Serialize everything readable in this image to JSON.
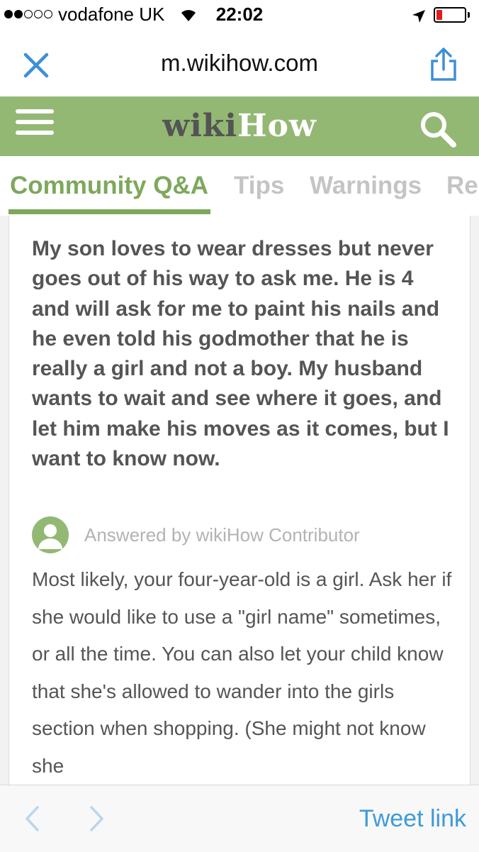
{
  "status_bar": {
    "carrier": "vodafone UK",
    "time": "22:02",
    "signal_bars_filled": 2,
    "signal_bars_total": 5,
    "battery_level": "low",
    "battery_color": "#e01d1d"
  },
  "browser": {
    "url": "m.wikihow.com",
    "close_icon": "close-icon",
    "share_icon": "share-icon"
  },
  "header": {
    "logo_wiki": "wiki",
    "logo_how": "How",
    "menu_icon": "hamburger-menu-icon",
    "search_icon": "search-icon",
    "brand_color": "#93b874"
  },
  "tabs": [
    {
      "label": "Community Q&A",
      "active": true
    },
    {
      "label": "Tips",
      "active": false
    },
    {
      "label": "Warnings",
      "active": false
    },
    {
      "label": "Re",
      "active": false
    }
  ],
  "qa": {
    "question": "My son loves to wear dresses but never goes out of his way to ask me. He is 4 and will ask for me to paint his nails and he even told his godmother that he is really a girl and not a boy. My husband wants to wait and see where it goes, and let him make his moves as it comes, but I want to know now.",
    "answered_by": "Answered by wikiHow Contributor",
    "answer": "Most likely, your four-year-old is a girl. Ask her if she would like to use a \"girl name\" sometimes, or all the time. You can also let your child know that she's allowed to wander into the girls section when shopping. (She might not know she"
  },
  "toolbar": {
    "back_icon": "chevron-left-icon",
    "forward_icon": "chevron-right-icon",
    "tweet_link_label": "Tweet link",
    "link_color": "#3d9ad8"
  }
}
